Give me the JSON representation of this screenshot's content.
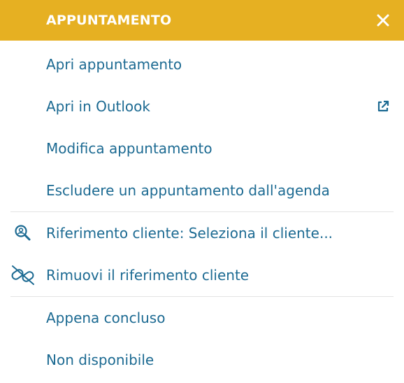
{
  "header": {
    "title": "APPUNTAMENTO",
    "close_icon": "close-icon"
  },
  "groups": [
    {
      "items": [
        {
          "label": "Apri appuntamento"
        },
        {
          "label": "Apri in Outlook",
          "trail_icon": "external-link-icon"
        },
        {
          "label": "Modifica appuntamento"
        },
        {
          "label": "Escludere un appuntamento dall'agenda"
        }
      ]
    },
    {
      "items": [
        {
          "label": "Riferimento cliente: Seleziona il cliente...",
          "icon": "search-client-icon"
        },
        {
          "label": "Rimuovi il riferimento cliente",
          "icon": "unlink-icon"
        }
      ]
    },
    {
      "items": [
        {
          "label": "Appena concluso"
        },
        {
          "label": "Non disponibile"
        }
      ]
    }
  ],
  "colors": {
    "header_bg": "#e6b022",
    "header_text": "#ffffff",
    "item_text": "#1c6a92",
    "divider": "#e3e3e3"
  }
}
